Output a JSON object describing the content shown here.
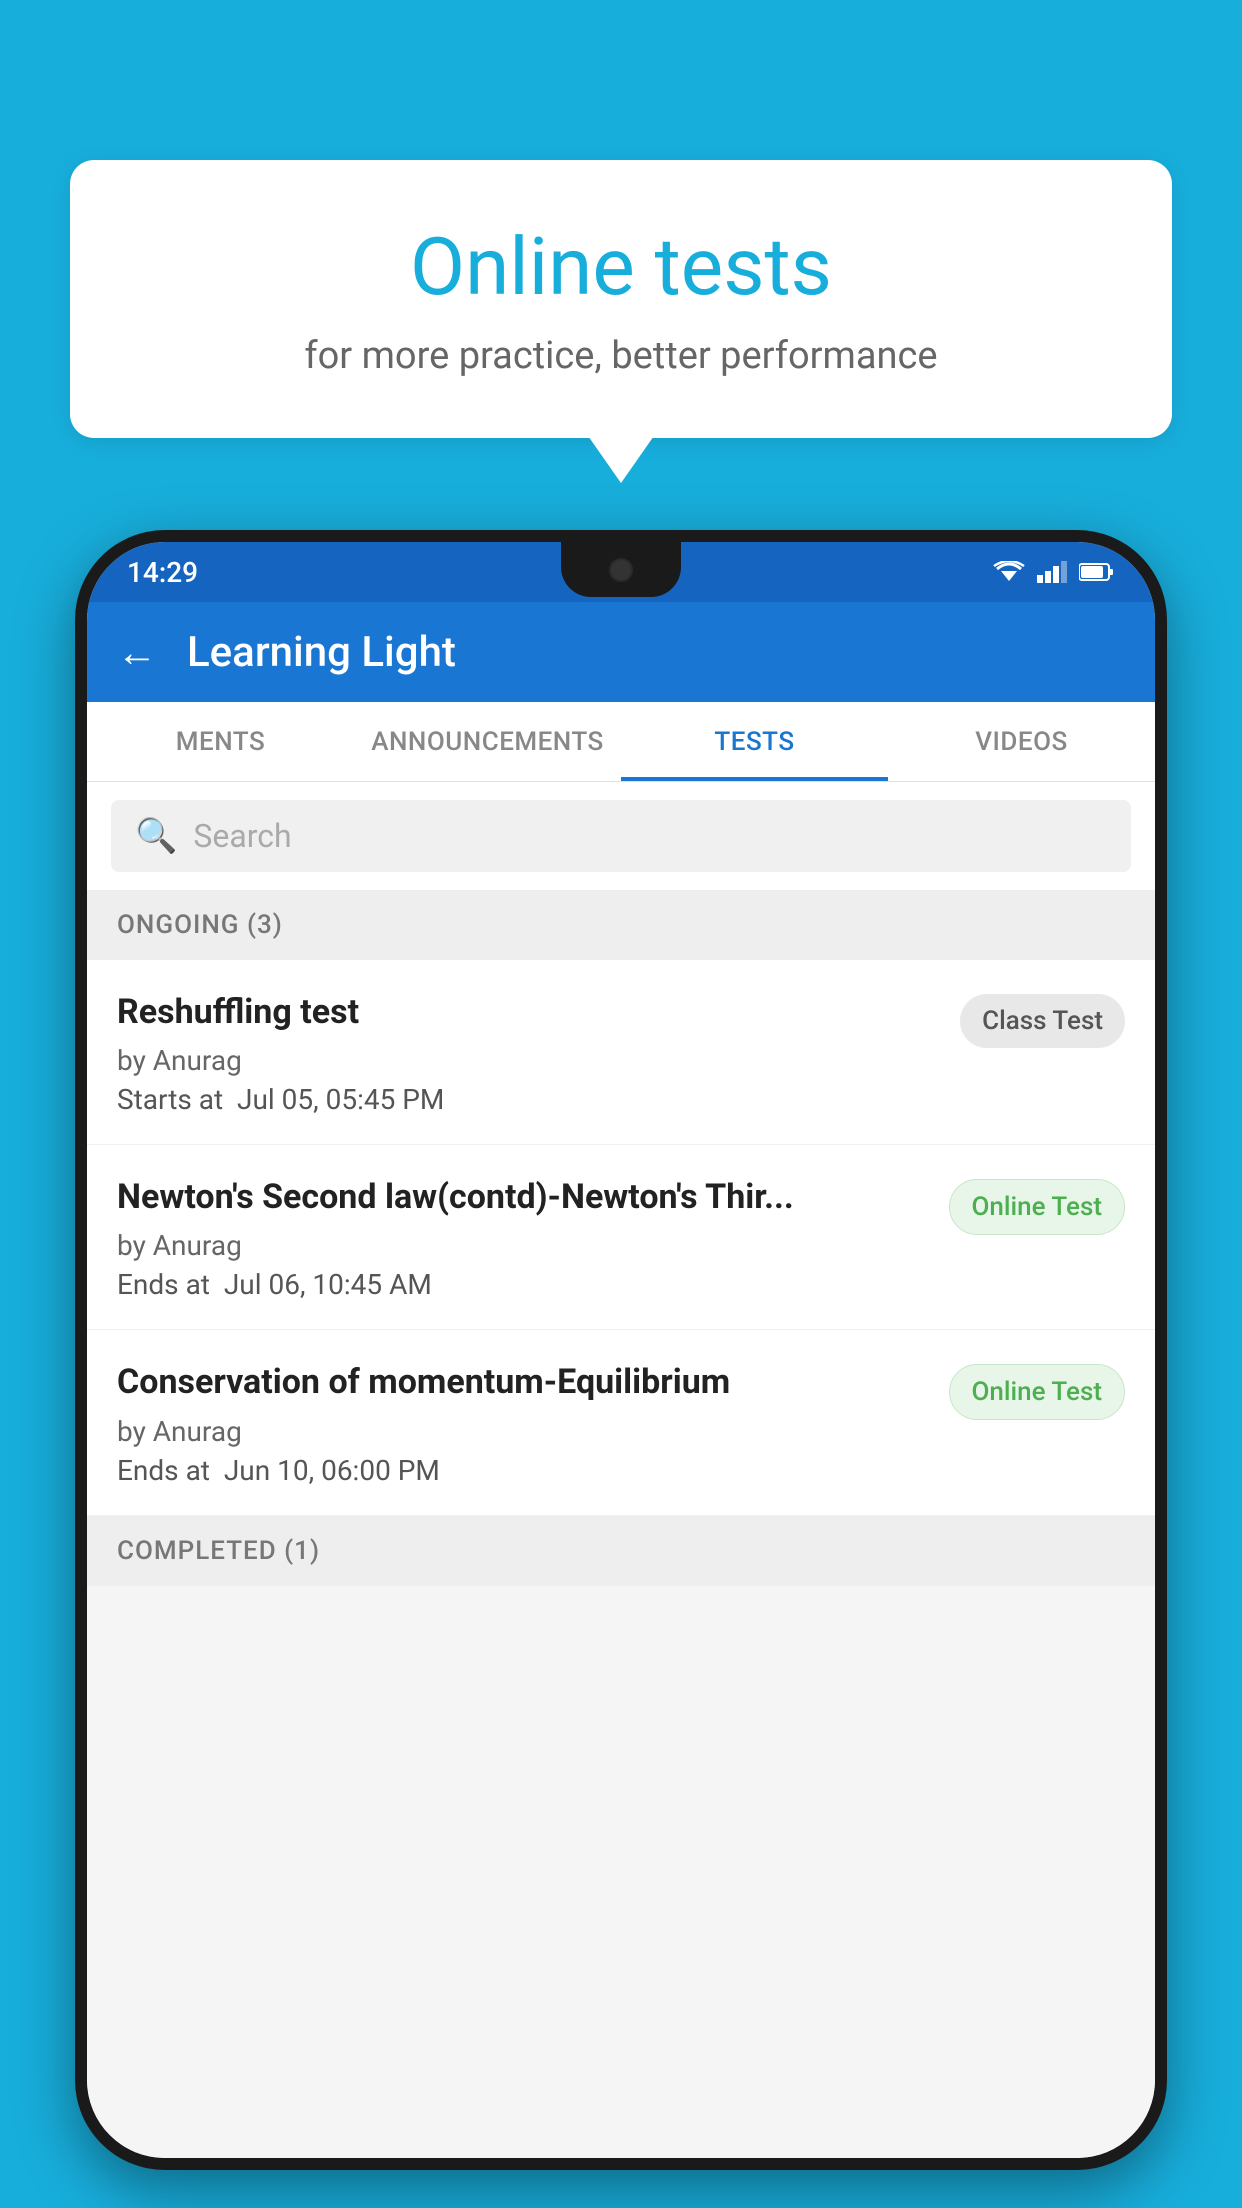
{
  "background": {
    "color": "#18AEDC"
  },
  "speech_bubble": {
    "title": "Online tests",
    "subtitle": "for more practice, better performance"
  },
  "status_bar": {
    "time": "14:29"
  },
  "app_bar": {
    "title": "Learning Light",
    "back_label": "←"
  },
  "tabs": [
    {
      "label": "MENTS",
      "active": false
    },
    {
      "label": "ANNOUNCEMENTS",
      "active": false
    },
    {
      "label": "TESTS",
      "active": true
    },
    {
      "label": "VIDEOS",
      "active": false
    }
  ],
  "search": {
    "placeholder": "Search"
  },
  "ongoing_section": {
    "title": "ONGOING (3)"
  },
  "tests": [
    {
      "name": "Reshuffling test",
      "author": "by Anurag",
      "time_label": "Starts at",
      "time": "Jul 05, 05:45 PM",
      "badge": "Class Test",
      "badge_type": "class"
    },
    {
      "name": "Newton's Second law(contd)-Newton's Thir...",
      "author": "by Anurag",
      "time_label": "Ends at",
      "time": "Jul 06, 10:45 AM",
      "badge": "Online Test",
      "badge_type": "online"
    },
    {
      "name": "Conservation of momentum-Equilibrium",
      "author": "by Anurag",
      "time_label": "Ends at",
      "time": "Jun 10, 06:00 PM",
      "badge": "Online Test",
      "badge_type": "online"
    }
  ],
  "completed_section": {
    "title": "COMPLETED (1)"
  }
}
